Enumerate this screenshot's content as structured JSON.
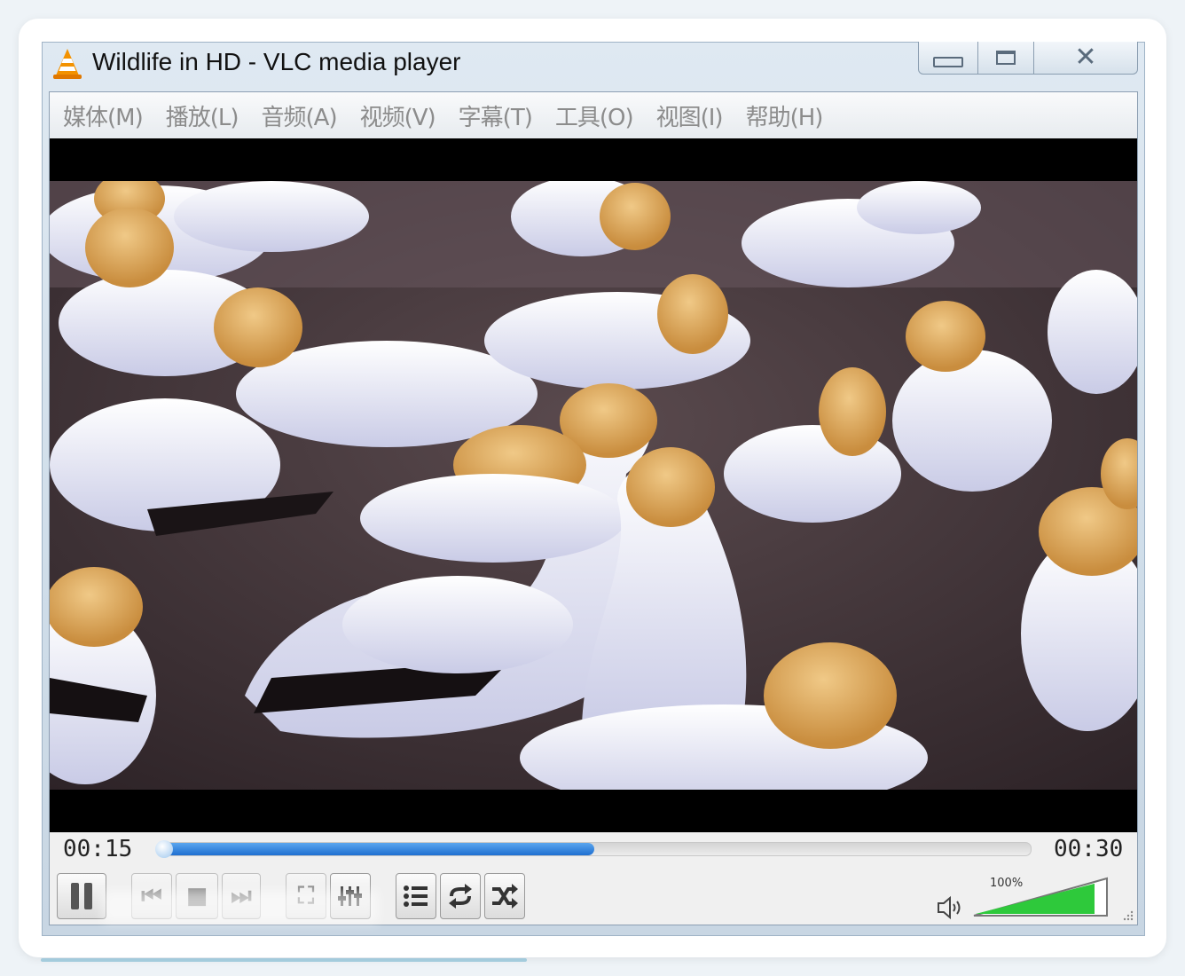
{
  "window": {
    "title": "Wildlife in HD - VLC media player"
  },
  "menu": {
    "items": [
      "媒体(M)",
      "播放(L)",
      "音频(A)",
      "视频(V)",
      "字幕(T)",
      "工具(O)",
      "视图(I)",
      "帮助(H)"
    ]
  },
  "playback": {
    "elapsed": "00:15",
    "duration": "00:30",
    "progress_fraction": 0.5
  },
  "volume": {
    "label": "100%",
    "level_fraction": 1.0
  },
  "icons": {
    "app": "vlc-cone-icon",
    "play_pause": "pause-icon",
    "playlist": "playlist-icon",
    "loop": "loop-icon",
    "shuffle": "shuffle-icon",
    "equalizer": "equalizer-icon",
    "speaker": "speaker-icon"
  },
  "colors": {
    "accent": "#1f6fd1",
    "volume_fill": "#2ec93b",
    "menu_text": "#8c8c8c"
  }
}
